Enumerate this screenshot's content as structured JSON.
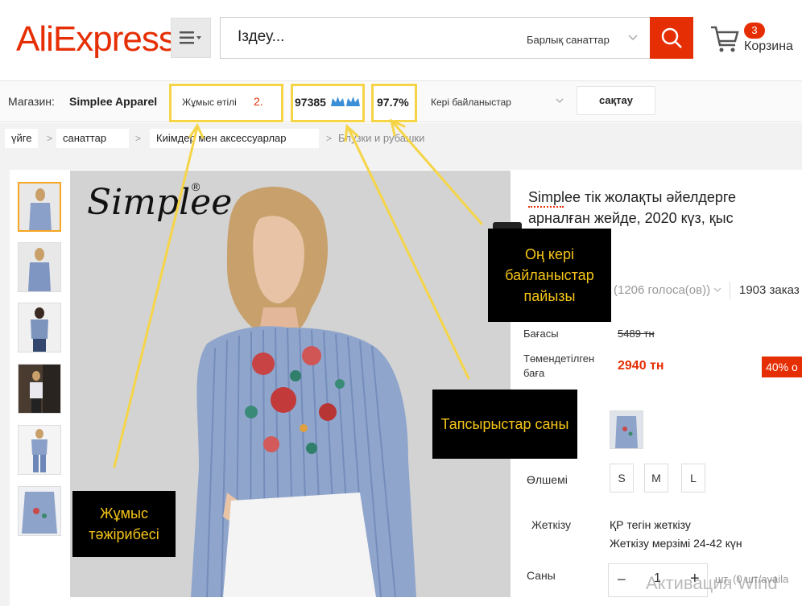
{
  "header": {
    "logo": "AliExpress",
    "logo_tm": "™",
    "search_placeholder": "Іздеу...",
    "category_select": "Барлық санаттар",
    "cart_count": "3",
    "cart_label": "Корзина"
  },
  "store_bar": {
    "store_label": "Магазин:",
    "store_name": "Simplee Apparel",
    "experience_label": "Жұмыс өтілі",
    "experience_value": "2.",
    "orders_count": "97385",
    "rating": "97.7%",
    "feedback_label": "Кері байланыстар",
    "save_label": "сақтау"
  },
  "breadcrumb": [
    "үйге",
    "санаттар",
    "Киімдер мен аксессуарлар",
    "Блузки и рубашки"
  ],
  "product": {
    "brand_overlay": "Simplee",
    "brand_reg": "®",
    "title": "Simplee тік жолақты әйелдерге арналған жейде, 2020 күз, қыс",
    "votes": "(1206 голоса(ов))",
    "orders_sold": "1903 заказ",
    "price_label": "Бағасы",
    "price_old": "5489 тн",
    "discount_price_label": "Төмендетілген баға",
    "price_new": "2940 тн",
    "discount_badge": "40% о",
    "size_label": "Өлшемі",
    "sizes": [
      "S",
      "M",
      "L"
    ],
    "delivery_label": "Жеткізу",
    "delivery_free": "ҚР тегін жеткізу",
    "delivery_time": "Жеткізу мерзімі 24-42 күн",
    "qty_label": "Саны",
    "qty_minus": "−",
    "qty_value": "1",
    "qty_plus": "+",
    "availability": "шт. (0 шт/availa"
  },
  "callouts": {
    "experience": "Жұмыс тәжірибесі",
    "orders": "Тапсырыстар саны",
    "feedback": "Оң кері байланыстар пайызы"
  },
  "watermark": "Активация Wind",
  "colors": {
    "accent": "#e62e04",
    "highlight": "#f5d547",
    "callout_text": "#f5c518"
  }
}
